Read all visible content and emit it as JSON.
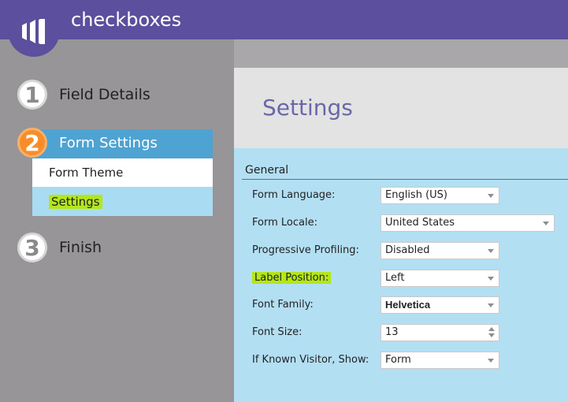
{
  "app": {
    "title": "checkboxes",
    "logo_icon": "marketo-logo-icon"
  },
  "steps": [
    {
      "number": "1",
      "label": "Field Details"
    },
    {
      "number": "2",
      "label": "Form Settings"
    },
    {
      "number": "3",
      "label": "Finish"
    }
  ],
  "submenu": {
    "items": [
      {
        "label": "Form Theme"
      },
      {
        "label": "Settings"
      }
    ]
  },
  "settings": {
    "title": "Settings",
    "section": "General",
    "fields": {
      "form_language": {
        "label": "Form Language:",
        "value": "English (US)"
      },
      "form_locale": {
        "label": "Form Locale:",
        "value": "United States"
      },
      "progressive_profiling": {
        "label": "Progressive Profiling:",
        "value": "Disabled"
      },
      "label_position": {
        "label": "Label Position:",
        "value": "Left"
      },
      "font_family": {
        "label": "Font Family:",
        "value": "Helvetica"
      },
      "font_size": {
        "label": "Font Size:",
        "value": "13"
      },
      "known_visitor": {
        "label": "If Known Visitor, Show:",
        "value": "Form"
      }
    }
  },
  "colors": {
    "header": "#5b4f9e",
    "step_active": "#4ea3d2",
    "step_badge_active": "#f78d2a",
    "highlight": "#b4e61b",
    "form_bg": "#b3dff3"
  }
}
